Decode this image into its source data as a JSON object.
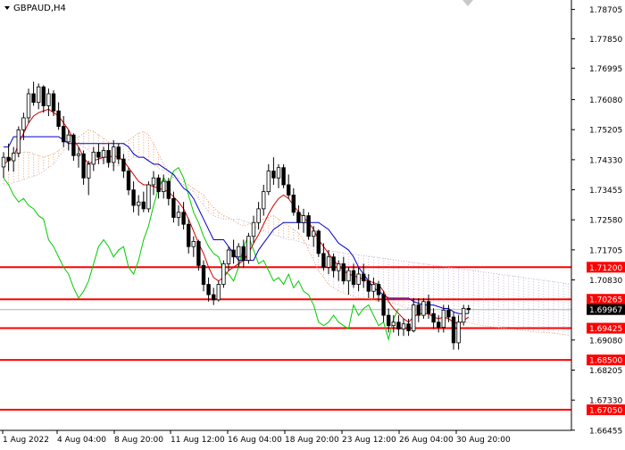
{
  "header": {
    "symbol_label": "GBPAUD,H4"
  },
  "colors": {
    "background": "#ffffff",
    "axis": "#000000",
    "candle": "#000000",
    "tenkan_sen": "#d00000",
    "kijun_sen": "#0000cc",
    "chikou_span": "#00cc00",
    "senkou_span_a": "#e8a070",
    "senkou_span_b": "#c8b4d8",
    "level_line": "#ff0000",
    "price_label_bg": "#ff0000",
    "price_label_text": "#ffffff",
    "current_price_bg": "#000000",
    "current_price_line": "#b0b0b0"
  },
  "chart_data": {
    "type": "candlestick",
    "symbol": "GBPAUD",
    "timeframe": "H4",
    "indicator": "Ichimoku Kinko Hyo",
    "y_axis": {
      "ylim": [
        1.6645,
        1.7898
      ],
      "tick_labels": [
        "1.78705",
        "1.77850",
        "1.76995",
        "1.76080",
        "1.75205",
        "1.74330",
        "1.73455",
        "1.72580",
        "1.71705",
        "1.70830",
        "1.69080",
        "1.68205",
        "1.67330",
        "1.66455"
      ]
    },
    "x_axis": {
      "tick_labels": [
        "1 Aug 2022",
        "4 Aug 04:00",
        "8 Aug 20:00",
        "11 Aug 12:00",
        "16 Aug 04:00",
        "18 Aug 20:00",
        "23 Aug 12:00",
        "26 Aug 04:00",
        "30 Aug 20:00"
      ]
    },
    "current_price": 1.69967,
    "horizontal_levels": [
      1.712,
      1.70265,
      1.69425,
      1.685,
      1.6705
    ],
    "level_labels": [
      "1.71200",
      "1.70265",
      "1.69425",
      "1.68500",
      "1.67050"
    ],
    "current_price_label": "1.69967",
    "candles": [
      [
        1.7412,
        1.7455,
        1.738,
        1.744
      ],
      [
        1.744,
        1.748,
        1.74,
        1.743
      ],
      [
        1.743,
        1.747,
        1.7398,
        1.7452
      ],
      [
        1.7452,
        1.753,
        1.744,
        1.752
      ],
      [
        1.752,
        1.757,
        1.749,
        1.7555
      ],
      [
        1.7555,
        1.764,
        1.754,
        1.7625
      ],
      [
        1.7625,
        1.766,
        1.759,
        1.76
      ],
      [
        1.76,
        1.7655,
        1.758,
        1.7645
      ],
      [
        1.7645,
        1.765,
        1.757,
        1.759
      ],
      [
        1.759,
        1.764,
        1.756,
        1.7625
      ],
      [
        1.7625,
        1.7635,
        1.756,
        1.7575
      ],
      [
        1.7575,
        1.76,
        1.752,
        1.753
      ],
      [
        1.753,
        1.756,
        1.747,
        1.7485
      ],
      [
        1.7485,
        1.752,
        1.746,
        1.7505
      ],
      [
        1.7505,
        1.751,
        1.743,
        1.7445
      ],
      [
        1.7445,
        1.747,
        1.741,
        1.745
      ],
      [
        1.745,
        1.746,
        1.736,
        1.738
      ],
      [
        1.738,
        1.743,
        1.733,
        1.742
      ],
      [
        1.742,
        1.747,
        1.74,
        1.7455
      ],
      [
        1.7455,
        1.748,
        1.742,
        1.744
      ],
      [
        1.744,
        1.747,
        1.742,
        1.746
      ],
      [
        1.746,
        1.748,
        1.741,
        1.7425
      ],
      [
        1.7425,
        1.749,
        1.74,
        1.747
      ],
      [
        1.747,
        1.748,
        1.742,
        1.7435
      ],
      [
        1.7435,
        1.745,
        1.738,
        1.74
      ],
      [
        1.74,
        1.741,
        1.733,
        1.7345
      ],
      [
        1.7345,
        1.737,
        1.728,
        1.73
      ],
      [
        1.73,
        1.733,
        1.727,
        1.731
      ],
      [
        1.731,
        1.734,
        1.728,
        1.729
      ],
      [
        1.729,
        1.737,
        1.728,
        1.736
      ],
      [
        1.736,
        1.74,
        1.733,
        1.738
      ],
      [
        1.738,
        1.739,
        1.732,
        1.734
      ],
      [
        1.734,
        1.739,
        1.732,
        1.737
      ],
      [
        1.737,
        1.738,
        1.73,
        1.732
      ],
      [
        1.732,
        1.734,
        1.725,
        1.7265
      ],
      [
        1.7265,
        1.73,
        1.724,
        1.728
      ],
      [
        1.728,
        1.731,
        1.723,
        1.7245
      ],
      [
        1.7245,
        1.726,
        1.716,
        1.718
      ],
      [
        1.718,
        1.721,
        1.715,
        1.7195
      ],
      [
        1.7195,
        1.72,
        1.711,
        1.7125
      ],
      [
        1.7125,
        1.714,
        1.705,
        1.707
      ],
      [
        1.707,
        1.709,
        1.702,
        1.704
      ],
      [
        1.704,
        1.706,
        1.701,
        1.7025
      ],
      [
        1.7025,
        1.708,
        1.702,
        1.707
      ],
      [
        1.707,
        1.714,
        1.706,
        1.713
      ],
      [
        1.713,
        1.718,
        1.711,
        1.717
      ],
      [
        1.717,
        1.72,
        1.713,
        1.715
      ],
      [
        1.715,
        1.719,
        1.712,
        1.718
      ],
      [
        1.718,
        1.72,
        1.712,
        1.714
      ],
      [
        1.714,
        1.722,
        1.713,
        1.721
      ],
      [
        1.721,
        1.727,
        1.719,
        1.725
      ],
      [
        1.725,
        1.731,
        1.723,
        1.729
      ],
      [
        1.729,
        1.736,
        1.727,
        1.734
      ],
      [
        1.734,
        1.742,
        1.733,
        1.74
      ],
      [
        1.74,
        1.744,
        1.736,
        1.738
      ],
      [
        1.738,
        1.742,
        1.735,
        1.741
      ],
      [
        1.741,
        1.742,
        1.735,
        1.736
      ],
      [
        1.736,
        1.739,
        1.732,
        1.733
      ],
      [
        1.733,
        1.735,
        1.727,
        1.728
      ],
      [
        1.728,
        1.73,
        1.723,
        1.725
      ],
      [
        1.725,
        1.729,
        1.722,
        1.727
      ],
      [
        1.727,
        1.728,
        1.72,
        1.721
      ],
      [
        1.721,
        1.724,
        1.718,
        1.7225
      ],
      [
        1.7225,
        1.723,
        1.715,
        1.716
      ],
      [
        1.716,
        1.719,
        1.711,
        1.712
      ],
      [
        1.712,
        1.717,
        1.71,
        1.715
      ],
      [
        1.715,
        1.716,
        1.709,
        1.711
      ],
      [
        1.711,
        1.714,
        1.708,
        1.713
      ],
      [
        1.713,
        1.715,
        1.707,
        1.708
      ],
      [
        1.708,
        1.712,
        1.704,
        1.711
      ],
      [
        1.711,
        1.713,
        1.706,
        1.707
      ],
      [
        1.707,
        1.712,
        1.705,
        1.71
      ],
      [
        1.71,
        1.713,
        1.706,
        1.708
      ],
      [
        1.708,
        1.71,
        1.703,
        1.705
      ],
      [
        1.705,
        1.709,
        1.703,
        1.707
      ],
      [
        1.707,
        1.708,
        1.702,
        1.704
      ],
      [
        1.704,
        1.705,
        1.696,
        1.698
      ],
      [
        1.698,
        1.7,
        1.693,
        1.695
      ],
      [
        1.695,
        1.698,
        1.693,
        1.696
      ],
      [
        1.696,
        1.698,
        1.692,
        1.694
      ],
      [
        1.694,
        1.697,
        1.692,
        1.6955
      ],
      [
        1.6955,
        1.697,
        1.692,
        1.6935
      ],
      [
        1.6935,
        1.703,
        1.693,
        1.701
      ],
      [
        1.701,
        1.703,
        1.696,
        1.698
      ],
      [
        1.698,
        1.703,
        1.697,
        1.702
      ],
      [
        1.702,
        1.704,
        1.697,
        1.6985
      ],
      [
        1.6985,
        1.7,
        1.694,
        1.696
      ],
      [
        1.696,
        1.698,
        1.693,
        1.6945
      ],
      [
        1.6945,
        1.701,
        1.693,
        1.6995
      ],
      [
        1.6995,
        1.701,
        1.696,
        1.6975
      ],
      [
        1.6975,
        1.699,
        1.688,
        1.69
      ],
      [
        1.69,
        1.698,
        1.688,
        1.696
      ],
      [
        1.696,
        1.701,
        1.695,
        1.7
      ],
      [
        1.7,
        1.701,
        1.6985,
        1.69967
      ]
    ],
    "tenkan_sen": [
      1.742,
      1.743,
      1.744,
      1.748,
      1.751,
      1.754,
      1.756,
      1.757,
      1.7575,
      1.758,
      1.757,
      1.756,
      1.754,
      1.752,
      1.749,
      1.747,
      1.744,
      1.742,
      1.743,
      1.7435,
      1.744,
      1.744,
      1.7445,
      1.744,
      1.743,
      1.741,
      1.739,
      1.737,
      1.736,
      1.736,
      1.7355,
      1.735,
      1.7345,
      1.734,
      1.7325,
      1.731,
      1.729,
      1.726,
      1.7225,
      1.719,
      1.716,
      1.712,
      1.709,
      1.708,
      1.709,
      1.711,
      1.712,
      1.713,
      1.714,
      1.716,
      1.719,
      1.7215,
      1.7245,
      1.7275,
      1.73,
      1.732,
      1.733,
      1.732,
      1.73,
      1.728,
      1.7265,
      1.725,
      1.723,
      1.72,
      1.718,
      1.716,
      1.714,
      1.7125,
      1.711,
      1.71,
      1.7095,
      1.709,
      1.7085,
      1.708,
      1.7075,
      1.707,
      1.705,
      1.702,
      1.7,
      1.6985,
      1.697,
      1.696,
      1.6975,
      1.6985,
      1.6985,
      1.6985,
      1.6975,
      1.697,
      1.6975,
      1.697,
      1.696,
      1.6955,
      1.6965,
      1.6975
    ],
    "kijun_sen": [
      1.747,
      1.747,
      1.75,
      1.75,
      1.75,
      1.75,
      1.75,
      1.75,
      1.75,
      1.75,
      1.75,
      1.75,
      1.749,
      1.748,
      1.748,
      1.748,
      1.748,
      1.748,
      1.748,
      1.748,
      1.748,
      1.748,
      1.748,
      1.748,
      1.748,
      1.747,
      1.745,
      1.744,
      1.744,
      1.743,
      1.742,
      1.742,
      1.741,
      1.74,
      1.739,
      1.737,
      1.735,
      1.734,
      1.732,
      1.729,
      1.726,
      1.723,
      1.72,
      1.72,
      1.72,
      1.718,
      1.716,
      1.714,
      1.714,
      1.714,
      1.714,
      1.717,
      1.719,
      1.721,
      1.723,
      1.724,
      1.725,
      1.725,
      1.725,
      1.725,
      1.725,
      1.725,
      1.725,
      1.725,
      1.724,
      1.723,
      1.721,
      1.719,
      1.718,
      1.717,
      1.715,
      1.712,
      1.71,
      1.708,
      1.706,
      1.705,
      1.704,
      1.703,
      1.703,
      1.703,
      1.703,
      1.703,
      1.702,
      1.7015,
      1.701,
      1.701,
      1.701,
      1.7005,
      1.7,
      1.7,
      1.699,
      1.6985,
      1.6985,
      1.6985
    ],
    "chikou_span": [
      1.738,
      1.736,
      1.733,
      1.731,
      1.732,
      1.73,
      1.729,
      1.727,
      1.726,
      1.72,
      1.718,
      1.715,
      1.712,
      1.71,
      1.706,
      1.703,
      1.705,
      1.708,
      1.713,
      1.718,
      1.72,
      1.718,
      1.715,
      1.717,
      1.718,
      1.712,
      1.71,
      1.714,
      1.72,
      1.724,
      1.73,
      1.735,
      1.738,
      1.736,
      1.74,
      1.741,
      1.738,
      1.733,
      1.728,
      1.725,
      1.721,
      1.718,
      1.716,
      1.715,
      1.711,
      1.71,
      1.708,
      1.712,
      1.718,
      1.721,
      1.717,
      1.713,
      1.714,
      1.711,
      1.708,
      1.709,
      1.707,
      1.71,
      1.706,
      1.708,
      1.705,
      1.704,
      1.701,
      1.696,
      1.695,
      1.696,
      1.698,
      1.696,
      1.695,
      1.694,
      1.701,
      1.698,
      1.7,
      1.701,
      1.698,
      1.695,
      1.696,
      1.691,
      1.697,
      1.7
    ],
    "senkou_span_a": [
      1.742,
      1.743,
      1.744,
      1.745,
      1.7455,
      1.7455,
      1.745,
      1.7445,
      1.744,
      1.7445,
      1.745,
      1.746,
      1.747,
      1.748,
      1.749,
      1.75,
      1.751,
      1.752,
      1.7515,
      1.7505,
      1.7495,
      1.7485,
      1.748,
      1.748,
      1.748,
      1.749,
      1.75,
      1.751,
      1.7515,
      1.7505,
      1.748,
      1.745,
      1.742,
      1.74,
      1.739,
      1.738,
      1.737,
      1.736,
      1.735,
      1.734,
      1.733,
      1.731,
      1.7295,
      1.728,
      1.727,
      1.7265,
      1.7255,
      1.7245,
      1.724,
      1.7245,
      1.725,
      1.7255,
      1.726,
      1.7265,
      1.727,
      1.726,
      1.725,
      1.724,
      1.723,
      1.722,
      1.72,
      1.717,
      1.714,
      1.711,
      1.709,
      1.707,
      1.706,
      1.705,
      1.7045,
      1.704,
      1.7035,
      1.703,
      1.703,
      1.7028,
      1.7025,
      1.702,
      1.702,
      1.7018,
      1.7015,
      1.701,
      1.7005,
      1.7,
      1.6995,
      1.699,
      1.6985,
      1.698,
      1.6975,
      1.697,
      1.6968,
      1.6965,
      1.6962,
      1.696,
      1.696,
      1.6958,
      1.6955,
      1.6952,
      1.695,
      1.6948,
      1.6946,
      1.6944,
      1.6942,
      1.694,
      1.694,
      1.6938,
      1.6936,
      1.6934,
      1.6932,
      1.693,
      1.693,
      1.693,
      1.6928,
      1.6926,
      1.6924,
      1.6922,
      1.692,
      1.6918,
      1.6918,
      1.6918,
      1.6916,
      1.6914,
      1.6912
    ],
    "senkou_span_b": [
      1.736,
      1.736,
      1.7365,
      1.737,
      1.7375,
      1.738,
      1.7385,
      1.739,
      1.74,
      1.741,
      1.742,
      1.744,
      1.746,
      1.747,
      1.748,
      1.748,
      1.747,
      1.746,
      1.745,
      1.744,
      1.743,
      1.742,
      1.7415,
      1.7415,
      1.742,
      1.743,
      1.744,
      1.744,
      1.744,
      1.743,
      1.742,
      1.741,
      1.74,
      1.739,
      1.738,
      1.737,
      1.736,
      1.735,
      1.734,
      1.732,
      1.73,
      1.728,
      1.727,
      1.7265,
      1.726,
      1.726,
      1.726,
      1.726,
      1.7255,
      1.725,
      1.724,
      1.723,
      1.7225,
      1.722,
      1.7215,
      1.721,
      1.7205,
      1.72,
      1.72,
      1.7195,
      1.719,
      1.7185,
      1.718,
      1.7175,
      1.717,
      1.7168,
      1.7166,
      1.7164,
      1.7162,
      1.716,
      1.7158,
      1.7156,
      1.7154,
      1.7152,
      1.715,
      1.7148,
      1.7146,
      1.7144,
      1.7142,
      1.714,
      1.7138,
      1.7136,
      1.7134,
      1.7132,
      1.713,
      1.7128,
      1.7126,
      1.7124,
      1.7122,
      1.712,
      1.7118,
      1.7116,
      1.7114,
      1.7112,
      1.711,
      1.7108,
      1.7106,
      1.7104,
      1.7102,
      1.71,
      1.7098,
      1.7096,
      1.7094,
      1.7092,
      1.709,
      1.7088,
      1.7086,
      1.7084,
      1.7082,
      1.708,
      1.7078,
      1.7076,
      1.7074,
      1.7072,
      1.707,
      1.7068,
      1.7066,
      1.7064,
      1.7062,
      1.706,
      1.7058
    ]
  }
}
